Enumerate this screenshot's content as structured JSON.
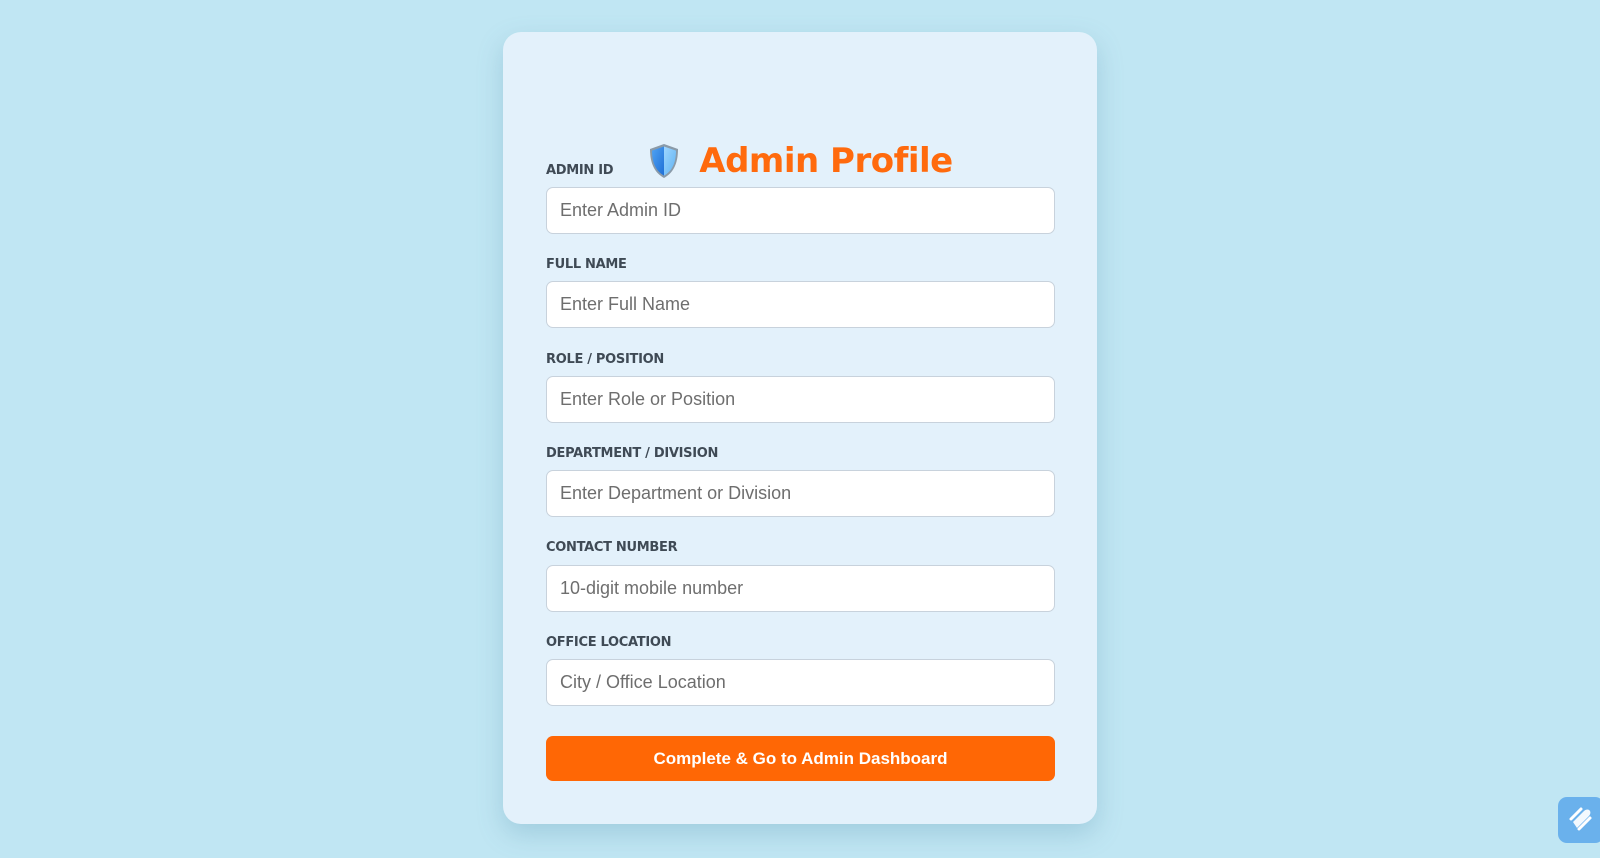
{
  "header": {
    "icon": "shield-icon",
    "title": "Admin Profile"
  },
  "form": {
    "fields": [
      {
        "label": "ADMIN ID",
        "placeholder": "Enter Admin ID",
        "value": ""
      },
      {
        "label": "FULL NAME",
        "placeholder": "Enter Full Name",
        "value": ""
      },
      {
        "label": "ROLE / POSITION",
        "placeholder": "Enter Role or Position",
        "value": ""
      },
      {
        "label": "DEPARTMENT / DIVISION",
        "placeholder": "Enter Department or Division",
        "value": ""
      },
      {
        "label": "CONTACT NUMBER",
        "placeholder": "10-digit mobile number",
        "value": ""
      },
      {
        "label": "OFFICE LOCATION",
        "placeholder": "City / Office Location",
        "value": ""
      }
    ],
    "submit_label": "Complete & Go to Admin Dashboard"
  },
  "corner_widget": {
    "icon": "pen-icon"
  },
  "colors": {
    "background": "#c0e6f3",
    "card": "#e3f1fb",
    "accent": "#ff6705",
    "label": "#3f4a55",
    "widget": "#6ab1ec"
  }
}
